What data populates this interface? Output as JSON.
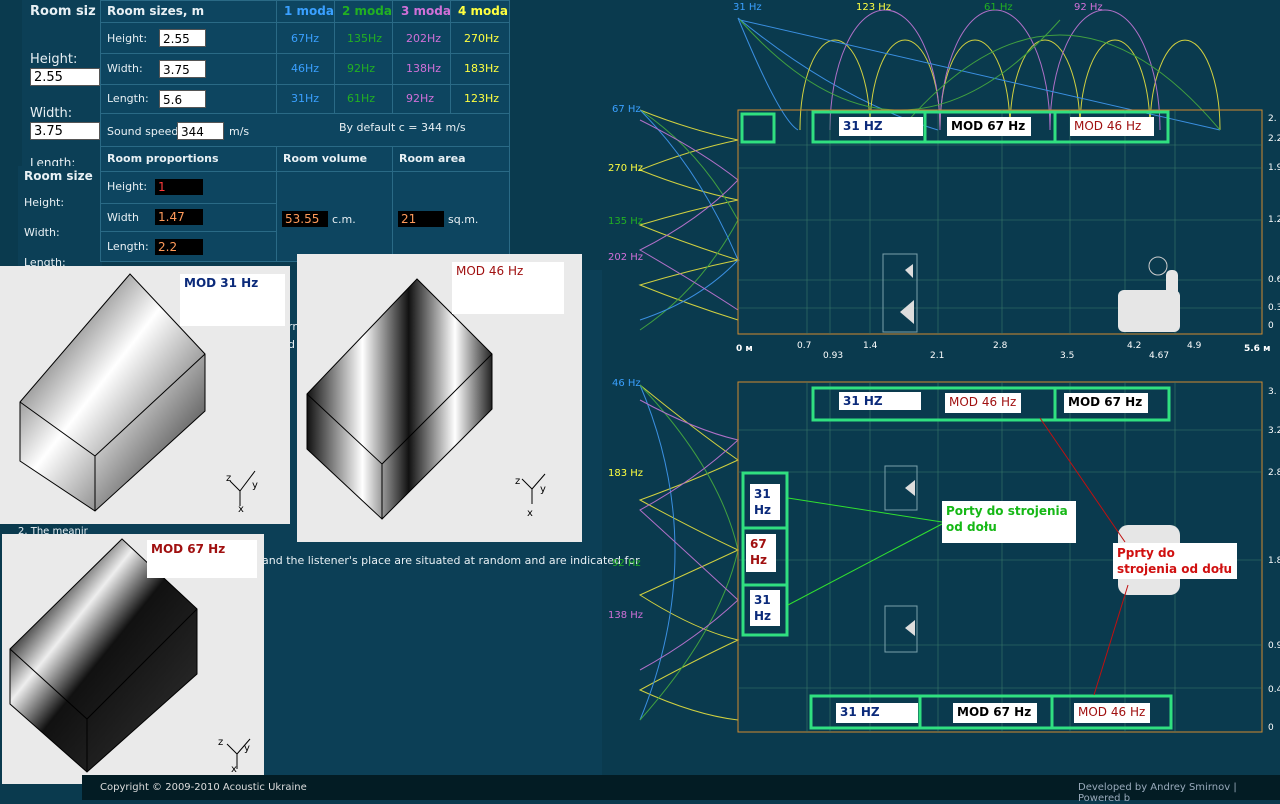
{
  "left_partial": {
    "title": "Room siz",
    "height_label": "Height:",
    "height_value": "2.55",
    "width_label": "Width:",
    "width_value": "3.75",
    "length_label": "Length:",
    "room_size2_title": "Room size",
    "h2": "Height:",
    "w2": "Width:",
    "l2": "Length:"
  },
  "table": {
    "title": "Room sizes, m",
    "modes": [
      "1 moda",
      "2 moda",
      "3 moda",
      "4 moda"
    ],
    "rows": [
      {
        "label": "Height:",
        "value": "2.55",
        "f": [
          "67Hz",
          "135Hz",
          "202Hz",
          "270Hz"
        ]
      },
      {
        "label": "Width:",
        "value": "3.75",
        "f": [
          "46Hz",
          "92Hz",
          "138Hz",
          "183Hz"
        ]
      },
      {
        "label": "Length:",
        "value": "5.6",
        "f": [
          "31Hz",
          "61Hz",
          "92Hz",
          "123Hz"
        ]
      }
    ],
    "sound_speed_label": "Sound speed:",
    "sound_speed": "344",
    "sound_unit": "m/s",
    "default_note": "By default c = 344 m/s",
    "prop_title": "Room proportions",
    "vol_title": "Room volume",
    "area_title": "Room area",
    "prop_rows": [
      {
        "label": "Height:",
        "value": "1"
      },
      {
        "label": "Width",
        "value": "1.47"
      },
      {
        "label": "Length:",
        "value": "2.2"
      }
    ],
    "volume": "53.55",
    "volume_unit": "c.m.",
    "area": "21",
    "area_unit": "sq.m."
  },
  "overlays": {
    "mod31": "MOD 31 Hz",
    "mod46": "MOD 46 Hz",
    "mod67": "MOD  67 Hz",
    "axis_z": "z",
    "axis_y": "y",
    "axis_x": "x"
  },
  "hidden_text": {
    "t1": "rn",
    "t2": "d",
    "t3": "2.  The meanir",
    "t4": "and the listener's place are situated at random and are indicated for"
  },
  "top_chart": {
    "top_labels": [
      "31 Hz",
      "123 Hz",
      "61 Hz",
      "92 Hz"
    ],
    "side_labels": [
      "67 Hz",
      "270 Hz",
      "135 Hz",
      "202 Hz"
    ],
    "x_ticks": [
      "0 м",
      "0.7",
      "0.93",
      "1.4",
      "2.1",
      "2.8",
      "3.5",
      "4.2",
      "4.67",
      "4.9",
      "5.6 м"
    ],
    "y_ticks": [
      "2.",
      "2.2",
      "1.9",
      "1.2",
      "0.6",
      "0.3",
      "0"
    ],
    "boxes": {
      "b31": "31 HZ",
      "b67": "MOD  67 Hz",
      "b46": "MOD 46 Hz"
    }
  },
  "bottom_chart": {
    "side_labels": [
      "46 Hz",
      "183 Hz",
      "92 Hz",
      "138 Hz"
    ],
    "y_ticks": [
      "3.",
      "3.2",
      "2.8",
      "1.8",
      "0.9",
      "0.4",
      "0"
    ],
    "boxes": {
      "top31": "31 HZ",
      "top46": "MOD 46 Hz",
      "top67": "MOD  67 Hz",
      "v31a": "31 Hz",
      "v67": "67 Hz",
      "v31b": "31 Hz",
      "bot31": "31 HZ",
      "bot67": "MOD  67 Hz",
      "bot46": "MOD 46 Hz"
    },
    "note_green": "Porty do strojenia od dołu",
    "note_red": "Pprty do strojenia od dołu"
  },
  "footer": {
    "copyright": "Copyright © 2009-2010 Acoustic Ukraine",
    "credit": "Developed by Andrey Smirnov | Powered b"
  }
}
